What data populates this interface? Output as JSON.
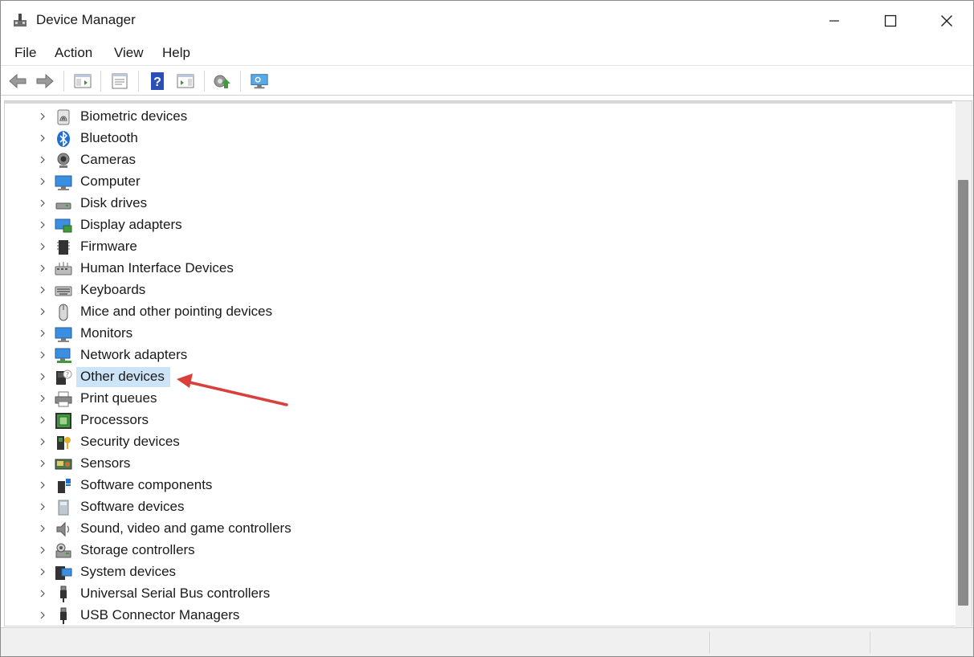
{
  "window": {
    "title": "Device Manager"
  },
  "menu": {
    "items": [
      "File",
      "Action",
      "View",
      "Help"
    ]
  },
  "toolbar": {
    "buttons": [
      "back-icon",
      "forward-icon",
      "show-hide-console-tree-icon",
      "properties-icon",
      "help-icon",
      "action-pane-icon",
      "update-driver-icon",
      "scan-hardware-icon"
    ]
  },
  "tree": {
    "selected": "Other devices",
    "items": [
      {
        "label": "Biometric devices",
        "icon": "fingerprint-icon"
      },
      {
        "label": "Bluetooth",
        "icon": "bluetooth-icon"
      },
      {
        "label": "Cameras",
        "icon": "camera-icon"
      },
      {
        "label": "Computer",
        "icon": "computer-icon"
      },
      {
        "label": "Disk drives",
        "icon": "disk-drive-icon"
      },
      {
        "label": "Display adapters",
        "icon": "display-adapter-icon"
      },
      {
        "label": "Firmware",
        "icon": "firmware-icon"
      },
      {
        "label": "Human Interface Devices",
        "icon": "hid-icon"
      },
      {
        "label": "Keyboards",
        "icon": "keyboard-icon"
      },
      {
        "label": "Mice and other pointing devices",
        "icon": "mouse-icon"
      },
      {
        "label": "Monitors",
        "icon": "monitor-icon"
      },
      {
        "label": "Network adapters",
        "icon": "network-adapter-icon"
      },
      {
        "label": "Other devices",
        "icon": "unknown-device-icon"
      },
      {
        "label": "Print queues",
        "icon": "printer-icon"
      },
      {
        "label": "Processors",
        "icon": "processor-icon"
      },
      {
        "label": "Security devices",
        "icon": "security-device-icon"
      },
      {
        "label": "Sensors",
        "icon": "sensor-icon"
      },
      {
        "label": "Software components",
        "icon": "software-component-icon"
      },
      {
        "label": "Software devices",
        "icon": "software-device-icon"
      },
      {
        "label": "Sound, video and game controllers",
        "icon": "speaker-icon"
      },
      {
        "label": "Storage controllers",
        "icon": "storage-controller-icon"
      },
      {
        "label": "System devices",
        "icon": "system-device-icon"
      },
      {
        "label": "Universal Serial Bus controllers",
        "icon": "usb-icon"
      },
      {
        "label": "USB Connector Managers",
        "icon": "usb-icon"
      }
    ]
  },
  "colors": {
    "selection": "#cce4f7",
    "annotation_arrow": "#d9403a",
    "toolbar_help": "#2b4fb5"
  }
}
